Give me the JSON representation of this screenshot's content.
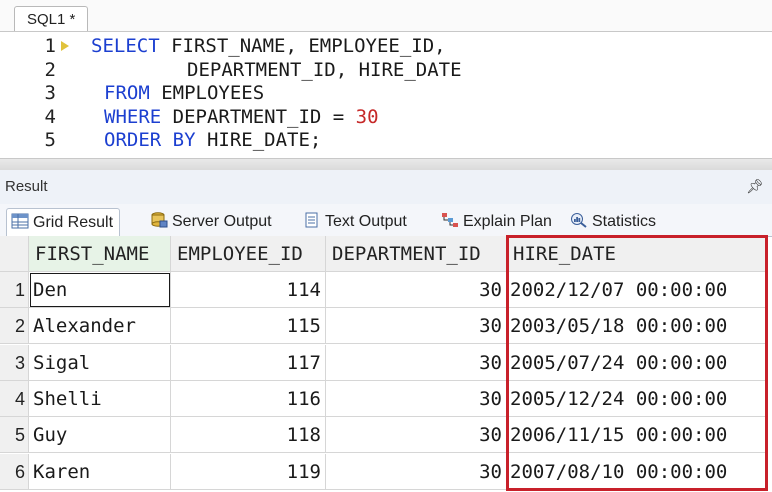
{
  "editor_tab": {
    "label": "SQL1 *"
  },
  "editor": {
    "lines": [
      {
        "number": "1",
        "parts": [
          {
            "text": "SELECT",
            "kind": "kw"
          },
          {
            "text": " FIRST_NAME, EMPLOYEE_ID,",
            "kind": "id"
          }
        ]
      },
      {
        "number": "2",
        "parts": [
          {
            "text": "DEPARTMENT_ID, HIRE_DATE",
            "kind": "id"
          }
        ]
      },
      {
        "number": "3",
        "parts": [
          {
            "text": "FROM",
            "kind": "kw"
          },
          {
            "text": " EMPLOYEES",
            "kind": "id"
          }
        ]
      },
      {
        "number": "4",
        "parts": [
          {
            "text": "WHERE",
            "kind": "kw"
          },
          {
            "text": " DEPARTMENT_ID = ",
            "kind": "id"
          },
          {
            "text": "30",
            "kind": "num"
          }
        ]
      },
      {
        "number": "5",
        "parts": [
          {
            "text": "ORDER BY",
            "kind": "kw"
          },
          {
            "text": " HIRE_DATE;",
            "kind": "id"
          }
        ]
      }
    ]
  },
  "result_panel": {
    "title": "Result",
    "pin_icon": "pin-icon",
    "tabs": [
      {
        "label": "Grid Result",
        "icon": "grid-icon",
        "active": true
      },
      {
        "label": "Server Output",
        "icon": "database-icon",
        "active": false
      },
      {
        "label": "Text Output",
        "icon": "document-icon",
        "active": false
      },
      {
        "label": "Explain Plan",
        "icon": "plan-icon",
        "active": false
      },
      {
        "label": "Statistics",
        "icon": "statistics-icon",
        "active": false
      }
    ]
  },
  "grid": {
    "columns": [
      "FIRST_NAME",
      "EMPLOYEE_ID",
      "DEPARTMENT_ID",
      "HIRE_DATE"
    ],
    "rows": [
      {
        "n": "1",
        "first_name": "Den",
        "employee_id": "114",
        "department_id": "30",
        "hire_date": "2002/12/07 00:00:00"
      },
      {
        "n": "2",
        "first_name": "Alexander",
        "employee_id": "115",
        "department_id": "30",
        "hire_date": "2003/05/18 00:00:00"
      },
      {
        "n": "3",
        "first_name": "Sigal",
        "employee_id": "117",
        "department_id": "30",
        "hire_date": "2005/07/24 00:00:00"
      },
      {
        "n": "4",
        "first_name": "Shelli",
        "employee_id": "116",
        "department_id": "30",
        "hire_date": "2005/12/24 00:00:00"
      },
      {
        "n": "5",
        "first_name": "Guy",
        "employee_id": "118",
        "department_id": "30",
        "hire_date": "2006/11/15 00:00:00"
      },
      {
        "n": "6",
        "first_name": "Karen",
        "employee_id": "119",
        "department_id": "30",
        "hire_date": "2007/08/10 00:00:00"
      }
    ]
  },
  "colors": {
    "keyword": "#1c3fd0",
    "number": "#c62828",
    "highlight": "#c8202a"
  }
}
